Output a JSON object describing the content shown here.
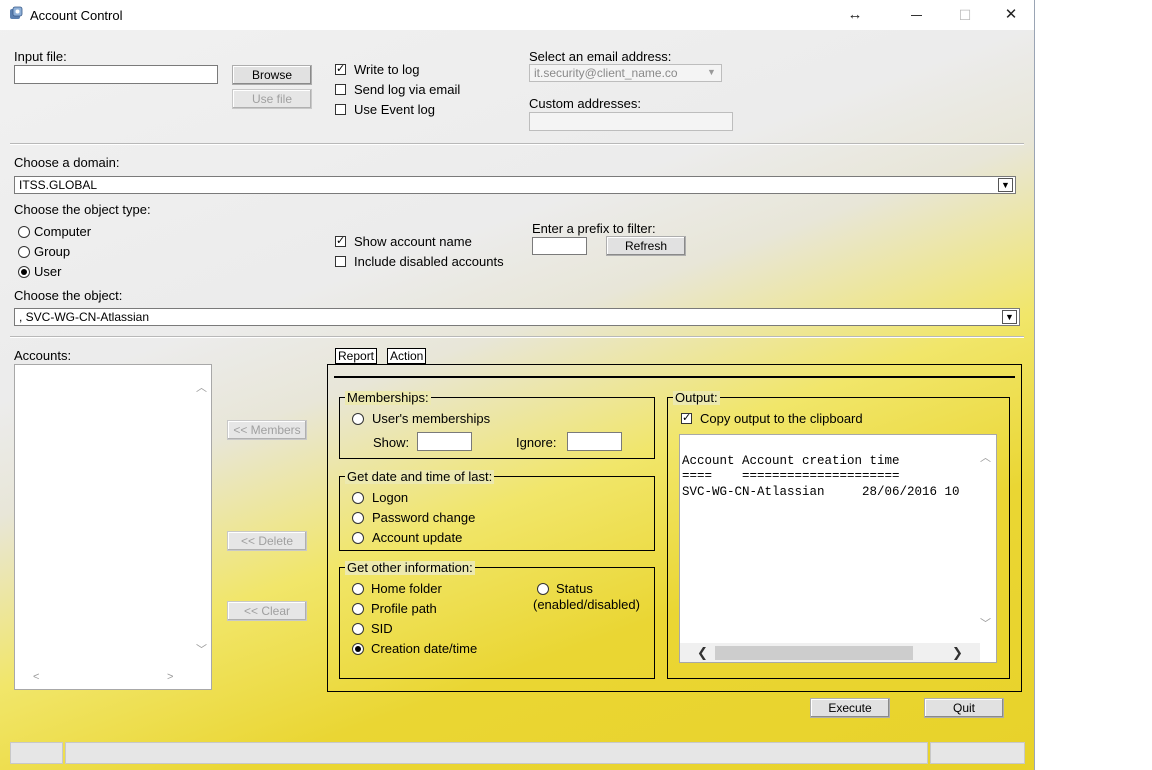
{
  "window": {
    "title": "Account Control",
    "move_glyph": "↔",
    "maximize_glyph": "☐",
    "close_glyph": "✕"
  },
  "file": {
    "input_label": "Input file:",
    "input_value": "",
    "browse_label": "Browse",
    "use_file_label": "Use file"
  },
  "log": {
    "write_to_log": "Write to log",
    "write_to_log_checked": true,
    "send_log_email": "Send log via email",
    "send_log_email_checked": false,
    "use_event_log": "Use Event log",
    "use_event_log_checked": false
  },
  "email": {
    "select_label": "Select an email address:",
    "selected": "it.security@client_name.co",
    "custom_label": "Custom addresses:",
    "custom_value": ""
  },
  "domain": {
    "label": "Choose a domain:",
    "selected": "ITSS.GLOBAL"
  },
  "object_type": {
    "label": "Choose the object type:",
    "options": [
      "Computer",
      "Group",
      "User"
    ],
    "selected": "User"
  },
  "options": {
    "show_account_name": "Show account name",
    "show_account_name_checked": true,
    "include_disabled": "Include disabled accounts",
    "include_disabled_checked": false
  },
  "filter": {
    "label": "Enter a prefix to filter:",
    "value": "",
    "refresh_label": "Refresh"
  },
  "object": {
    "label": "Choose the object:",
    "selected": ", SVC-WG-CN-Atlassian"
  },
  "accounts": {
    "label": "Accounts:",
    "items": []
  },
  "side_buttons": {
    "members": "<< Members",
    "delete": "<< Delete",
    "clear": "<< Clear"
  },
  "tabs": [
    {
      "label": "Report",
      "active": true
    },
    {
      "label": "Action",
      "active": false
    }
  ],
  "memberships": {
    "legend": "Memberships:",
    "users_memberships": "User's memberships",
    "show_label": "Show:",
    "show_value": "",
    "ignore_label": "Ignore:",
    "ignore_value": ""
  },
  "last": {
    "legend": "Get date and time of last:",
    "logon": "Logon",
    "password_change": "Password change",
    "account_update": "Account update"
  },
  "other": {
    "legend": "Get other information:",
    "home_folder": "Home folder",
    "profile_path": "Profile path",
    "sid": "SID",
    "creation": "Creation date/time",
    "status": "Status",
    "status_sub": "(enabled/disabled)",
    "selected": "Creation date/time"
  },
  "output": {
    "legend": "Output:",
    "copy_clipboard": "Copy output to the clipboard",
    "copy_checked": true,
    "lines": [
      "Account Account creation time",
      "====    =====================",
      "SVC-WG-CN-Atlassian     28/06/2016 10"
    ]
  },
  "actions": {
    "execute": "Execute",
    "quit": "Quit"
  },
  "colors": {
    "accent_yellow": "#ead633",
    "window_grey": "#ececec"
  }
}
